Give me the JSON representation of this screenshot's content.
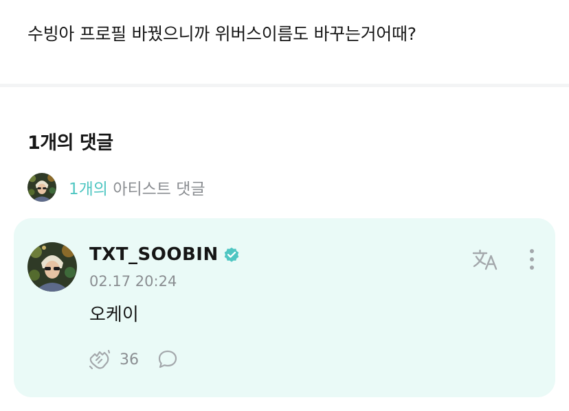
{
  "post": {
    "text": "수빙아 프로필 바꿨으니까 위버스이름도 바꾸는거어때?"
  },
  "comments_section": {
    "title": "1개의 댓글",
    "artist_count": "1개의",
    "artist_suffix": " 아티스트 댓글"
  },
  "comment": {
    "author": "TXT_SOOBIN",
    "verified_icon": "verified-badge-icon",
    "time": "02.17 20:24",
    "body": "오케이",
    "cheer_count": "36",
    "icons": {
      "translate": "translate-icon",
      "more": "more-vertical-icon",
      "cheer": "cheer-hands-icon",
      "reply": "reply-bubble-icon"
    }
  },
  "colors": {
    "accent": "#4fc6c2",
    "card_background": "#eafaf7",
    "muted_text": "#8a8d91",
    "icon_gray": "#a3a7ab"
  }
}
